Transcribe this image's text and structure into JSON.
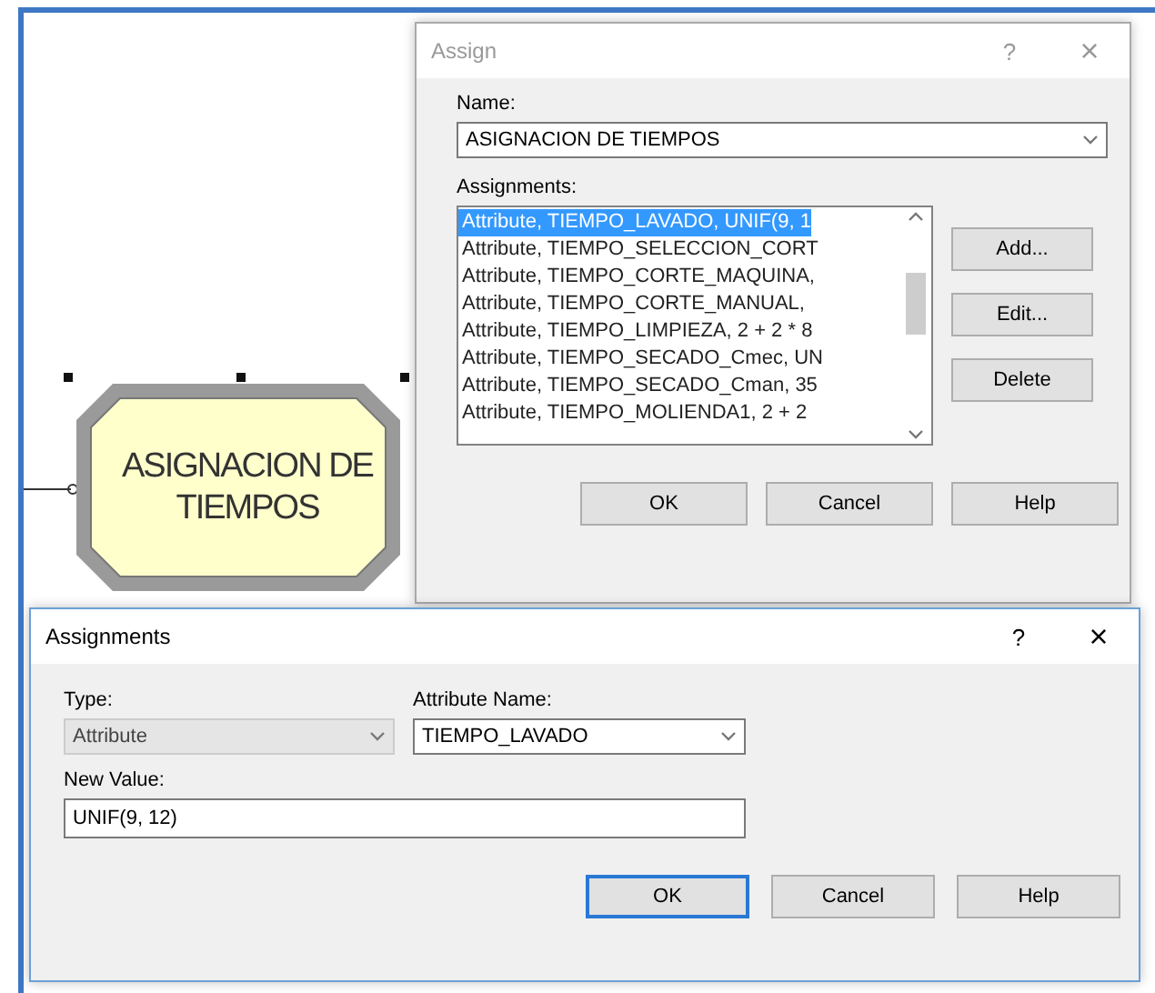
{
  "module": {
    "label": "ASIGNACION DE TIEMPOS",
    "selected": true
  },
  "assign_dialog": {
    "title": "Assign",
    "active": false,
    "help_icon": "?",
    "close_icon": "×",
    "name_label": "Name:",
    "name_value": "ASIGNACION DE TIEMPOS",
    "assignments_label": "Assignments:",
    "assignments": [
      {
        "text": "Attribute, TIEMPO_LAVADO, UNIF(9, 1",
        "selected": true
      },
      {
        "text": "Attribute, TIEMPO_SELECCION_CORT",
        "selected": false
      },
      {
        "text": "Attribute, TIEMPO_CORTE_MAQUINA,",
        "selected": false
      },
      {
        "text": "Attribute, TIEMPO_CORTE_MANUAL,",
        "selected": false
      },
      {
        "text": "Attribute, TIEMPO_LIMPIEZA, 2 + 2 * 8",
        "selected": false
      },
      {
        "text": "Attribute, TIEMPO_SECADO_Cmec, UN",
        "selected": false
      },
      {
        "text": "Attribute, TIEMPO_SECADO_Cman, 35",
        "selected": false
      },
      {
        "text": "Attribute, TIEMPO_MOLIENDA1, 2 + 2",
        "selected": false
      }
    ],
    "side_buttons": [
      "Add...",
      "Edit...",
      "Delete"
    ],
    "buttons": [
      {
        "label": "OK",
        "focused": false
      },
      {
        "label": "Cancel",
        "focused": false
      },
      {
        "label": "Help",
        "focused": false
      }
    ]
  },
  "assignments_dialog": {
    "title": "Assignments",
    "active": true,
    "help_icon": "?",
    "close_icon": "×",
    "type_label": "Type:",
    "type_value": "Attribute",
    "type_disabled": true,
    "attribute_label": "Attribute Name:",
    "attribute_value": "TIEMPO_LAVADO",
    "attribute_disabled": false,
    "new_value_label": "New Value:",
    "new_value": "UNIF(9, 12)",
    "buttons": [
      {
        "label": "OK",
        "focused": true
      },
      {
        "label": "Cancel",
        "focused": false
      },
      {
        "label": "Help",
        "focused": false
      }
    ]
  }
}
